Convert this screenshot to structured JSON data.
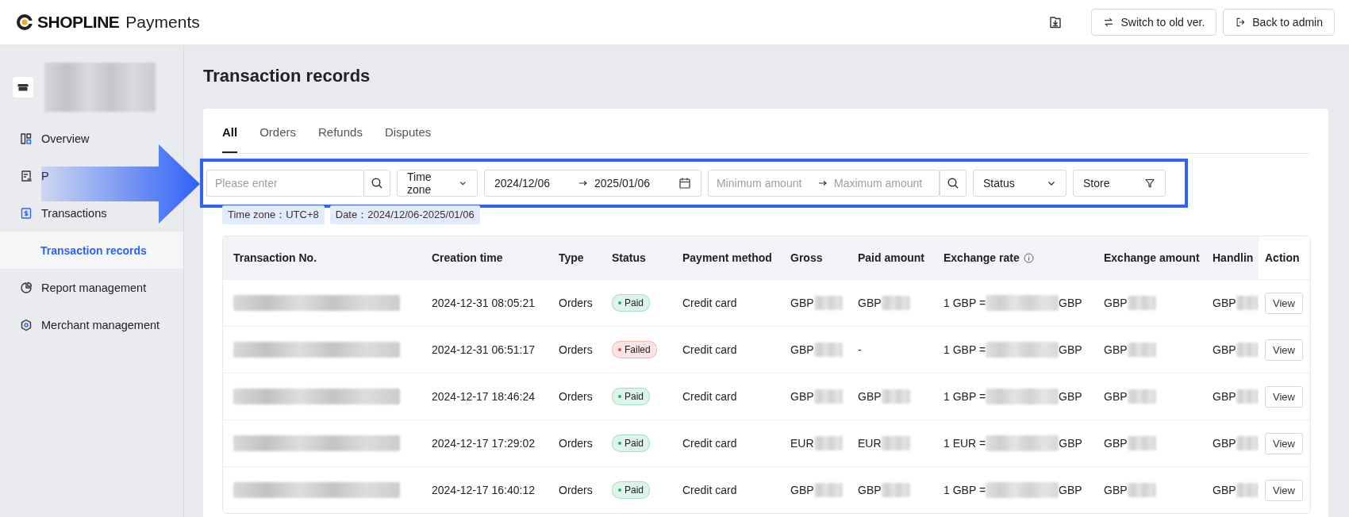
{
  "header": {
    "logo": {
      "brand": "SHOPLINE",
      "product": "Payments"
    },
    "buttons": [
      {
        "kind": "download"
      },
      {
        "kind": "switch",
        "label": "Switch to old ver."
      },
      {
        "kind": "exit",
        "label": "Back to admin"
      }
    ]
  },
  "sidebar": {
    "store": {
      "name_redacted": true
    },
    "items": [
      {
        "label": "Overview",
        "selected": false
      },
      {
        "label": "P",
        "selected": false
      },
      {
        "label": "Transactions",
        "selected": false,
        "expanded": true,
        "children": [
          {
            "label": "Transaction records",
            "selected": true
          }
        ]
      },
      {
        "label": "Report management",
        "selected": false
      },
      {
        "label": "Merchant management",
        "selected": false
      }
    ]
  },
  "page_title": "Transaction records",
  "tabs": [
    {
      "label": "All",
      "selected": true
    },
    {
      "label": "Orders",
      "selected": false
    },
    {
      "label": "Refunds",
      "selected": false
    },
    {
      "label": "Disputes",
      "selected": false
    }
  ],
  "filters": [
    {
      "kind": "search",
      "placeholder": "Please enter"
    },
    {
      "kind": "select",
      "label": "Time zone"
    },
    {
      "kind": "date_range",
      "start": "2024/12/06",
      "end": "2025/01/06"
    },
    {
      "kind": "amount_range",
      "min_placeholder": "Minimum amount",
      "max_placeholder": "Maximum amount"
    },
    {
      "kind": "select",
      "label": "Status"
    },
    {
      "kind": "filter",
      "label": "Store"
    }
  ],
  "active_filters": [
    "Time zone：UTC+8",
    "Date：2024/12/06-2025/01/06"
  ],
  "table": {
    "columns": [
      {
        "label": "Transaction No."
      },
      {
        "label": "Creation time"
      },
      {
        "label": "Type"
      },
      {
        "label": "Status"
      },
      {
        "label": "Payment method"
      },
      {
        "label": "Gross"
      },
      {
        "label": "Paid amount"
      },
      {
        "label": "Exchange rate",
        "info": true
      },
      {
        "label": "Exchange amount"
      },
      {
        "label": "Handlin"
      },
      {
        "label": "Action"
      }
    ],
    "rows": [
      {
        "cells": [
          {
            "redacted": true
          },
          {
            "text": "2024-12-31 08:05:21"
          },
          {
            "text": "Orders"
          },
          {
            "kind": "status",
            "text": "Paid",
            "color": "#18b26b"
          },
          {
            "text": "Credit card"
          },
          {
            "text": "GBP",
            "redacted": true
          },
          {
            "text": "GBP",
            "redacted": true
          },
          {
            "text": "1 GBP =",
            "redacted": true,
            "suffix": "GBP"
          },
          {
            "text": "GBP",
            "redacted": true
          },
          {
            "text": "GBP",
            "redacted": true
          },
          {
            "kind": "button",
            "text": "View"
          }
        ]
      },
      {
        "cells": [
          {
            "redacted": true
          },
          {
            "text": "2024-12-31 06:51:17"
          },
          {
            "text": "Orders"
          },
          {
            "kind": "status",
            "text": "Failed",
            "color": "#e5483d"
          },
          {
            "text": "Credit card"
          },
          {
            "text": "GBP",
            "redacted": true
          },
          {
            "text": "-"
          },
          {
            "text": "1 GBP =",
            "redacted": true,
            "suffix": "GBP"
          },
          {
            "text": "GBP",
            "redacted": true
          },
          {
            "text": "GBP",
            "redacted": true
          },
          {
            "kind": "button",
            "text": "View"
          }
        ]
      },
      {
        "cells": [
          {
            "redacted": true
          },
          {
            "text": "2024-12-17 18:46:24"
          },
          {
            "text": "Orders"
          },
          {
            "kind": "status",
            "text": "Paid",
            "color": "#18b26b"
          },
          {
            "text": "Credit card"
          },
          {
            "text": "GBP",
            "redacted": true
          },
          {
            "text": "GBP",
            "redacted": true
          },
          {
            "text": "1 GBP =",
            "redacted": true,
            "suffix": "GBP"
          },
          {
            "text": "GBP",
            "redacted": true
          },
          {
            "text": "GBP",
            "redacted": true
          },
          {
            "kind": "button",
            "text": "View"
          }
        ]
      },
      {
        "cells": [
          {
            "redacted": true
          },
          {
            "text": "2024-12-17 17:29:02"
          },
          {
            "text": "Orders"
          },
          {
            "kind": "status",
            "text": "Paid",
            "color": "#18b26b"
          },
          {
            "text": "Credit card"
          },
          {
            "text": "EUR",
            "redacted": true
          },
          {
            "text": "EUR",
            "redacted": true
          },
          {
            "text": "1 EUR =",
            "redacted": true,
            "suffix": "GBP"
          },
          {
            "text": "GBP",
            "redacted": true
          },
          {
            "text": "GBP",
            "redacted": true
          },
          {
            "kind": "button",
            "text": "View"
          }
        ]
      },
      {
        "cells": [
          {
            "redacted": true
          },
          {
            "text": "2024-12-17 16:40:12"
          },
          {
            "text": "Orders"
          },
          {
            "kind": "status",
            "text": "Paid",
            "color": "#18b26b"
          },
          {
            "text": "Credit card"
          },
          {
            "text": "GBP",
            "redacted": true
          },
          {
            "text": "GBP",
            "redacted": true
          },
          {
            "text": "1 GBP =",
            "redacted": true,
            "suffix": "GBP"
          },
          {
            "text": "GBP",
            "redacted": true
          },
          {
            "text": "GBP",
            "redacted": true
          },
          {
            "kind": "button",
            "text": "View"
          }
        ]
      }
    ]
  },
  "annotations": {
    "arrow": true,
    "highlight_frame": true
  }
}
